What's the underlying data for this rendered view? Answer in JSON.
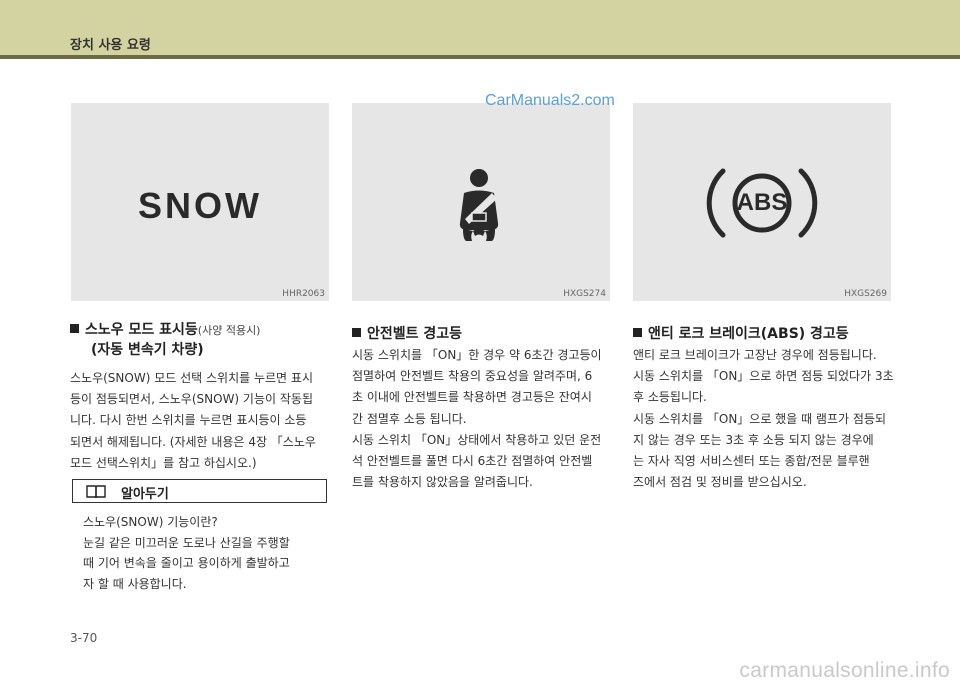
{
  "header": {
    "title": "장치 사용 요령"
  },
  "watermark": "CarManuals2.com",
  "images": [
    {
      "code": "HHR2063",
      "label": "SNOW"
    },
    {
      "code": "HXGS274"
    },
    {
      "code": "HXGS269",
      "abs_text": "ABS"
    }
  ],
  "sections": {
    "snow": {
      "title": "스노우 모드 표시등",
      "title_note": "(사양 적용시)",
      "title_line2": "(자동 변속기 차량)",
      "lines": [
        "스노우(SNOW) 모드 선택 스위치를 누르면 표시",
        "등이 점등되면서, 스노우(SNOW) 기능이 작동됩",
        "니다. 다시 한번 스위치를 누르면 표시등이 소등",
        "되면서 해제됩니다. (자세한 내용은 4장 「스노우",
        "모드 선택스위치」를 참고 하십시오.)"
      ]
    },
    "note": {
      "label": "알아두기",
      "lines": [
        "스노우(SNOW) 기능이란?",
        "눈길 같은 미끄러운 도로나 산길을 주행할",
        "때 기어 변속을 줄이고 용이하게 출발하고",
        "자 할 때 사용합니다."
      ]
    },
    "seatbelt": {
      "title": "안전벨트 경고등",
      "lines": [
        "시동 스위치를 「ON」한 경우 약 6초간 경고등이",
        "점멸하여 안전벨트 착용의 중요성을 알려주며, 6",
        "초 이내에 안전벨트를 착용하면 경고등은 잔여시",
        "간 점멸후 소등 됩니다.",
        "시동 스위치 「ON」상태에서 착용하고 있던 운전",
        "석 안전벨트를 풀면 다시 6초간 점멸하여 안전벨",
        "트를 착용하지 않았음을 알려줍니다."
      ]
    },
    "abs": {
      "title": "앤티 로크 브레이크(ABS) 경고등",
      "lines": [
        "앤티 로크 브레이크가 고장난 경우에 점등됩니다.",
        "시동 스위치를 「ON」으로 하면 점등 되었다가 3초",
        "후 소등됩니다.",
        "시동 스위치를 「ON」으로 했을 때 램프가 점등되",
        "지 않는 경우 또는 3초 후 소등 되지 않는 경우에",
        "는 자사 직영 서비스센터 또는 종합/전문 블루핸",
        "즈에서 점검 및 정비를 받으십시오."
      ]
    }
  },
  "page_number": "3-70",
  "footer": "carmanualsonline.info"
}
